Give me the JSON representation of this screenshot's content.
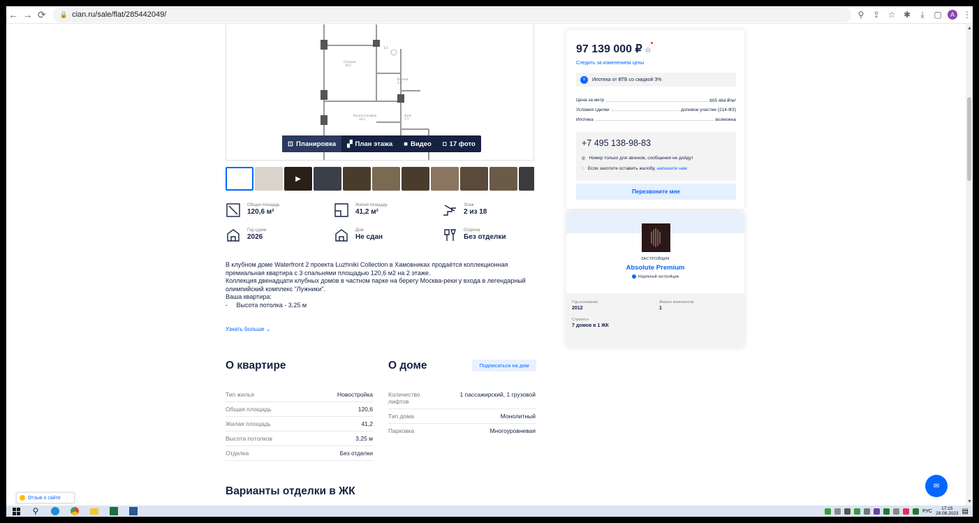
{
  "browser": {
    "url_host": "cian.ru",
    "url_path": "/sale/flat/285442049/"
  },
  "media": {
    "tabs": [
      {
        "label": "Планировка",
        "icon": "floorplan-icon"
      },
      {
        "label": "План этажа",
        "icon": "floor-plan-icon"
      },
      {
        "label": "Видео",
        "icon": "video-icon"
      },
      {
        "label": "17 фото",
        "icon": "camera-icon"
      }
    ],
    "thumb_colors": [
      "#ffffff",
      "#d8d4cc",
      "#2a1f17",
      "#3a3f49",
      "#4a3c2c",
      "#7a6a52",
      "#4b3b2c",
      "#8a7560",
      "#5a4a3a",
      "#6b5a48",
      "#3b3a3c",
      "#5a6070"
    ]
  },
  "facts": [
    {
      "label": "Общая площадь",
      "value": "120,6 м²",
      "icon": "area-icon"
    },
    {
      "label": "Жилая площадь",
      "value": "41,2 м²",
      "icon": "living-area-icon"
    },
    {
      "label": "Этаж",
      "value": "2 из 18",
      "icon": "stairs-icon"
    },
    {
      "label": "Год сдачи",
      "value": "2026",
      "icon": "building-year-icon"
    },
    {
      "label": "Дом",
      "value": "Не сдан",
      "icon": "building-icon"
    },
    {
      "label": "Отделка",
      "value": "Без отделки",
      "icon": "finishing-icon"
    }
  ],
  "description": {
    "lines": [
      "В клубном доме Waterfront 2 проекта Luzhniki Collection в Хамовниках продаётся коллекционная",
      "премиальная квартира с 3 спальнями площадью 120,6 м2 на 2 этаже.",
      "Коллекция двенадцати клубных домов в частном парке на берегу Москва-реки у входа в легендарный",
      "олимпийский комплекс \"Лужники\".",
      "Ваша квартира:",
      "-     Высота потолка - 3,25 м"
    ],
    "more": "Узнать больше"
  },
  "apartment": {
    "title": "О квартире",
    "rows": [
      {
        "k": "Тип жилья",
        "v": "Новостройка"
      },
      {
        "k": "Общая площадь",
        "v": "120,6"
      },
      {
        "k": "Жилая площадь",
        "v": "41,2"
      },
      {
        "k": "Высота потолков",
        "v": "3,25 м"
      },
      {
        "k": "Отделка",
        "v": "Без отделки"
      }
    ]
  },
  "house": {
    "title": "О доме",
    "subscribe": "Подписаться на дом",
    "rows": [
      {
        "k": "Количество лифтов",
        "v": "1 пассажирский, 1 грузовой"
      },
      {
        "k": "Тип дома",
        "v": "Монолитный"
      },
      {
        "k": "Парковка",
        "v": "Многоуровневая"
      }
    ]
  },
  "finishes_title": "Варианты отделки в ЖК",
  "price": {
    "value": "97 139 000 ₽",
    "follow": "Следить за изменением цены",
    "mortgage_promo": "Ипотека от ВТБ со скидкой 3%",
    "details": [
      {
        "k": "Цена за метр",
        "v": "805 464 ₽/м²"
      },
      {
        "k": "Условия сделки",
        "v": "долевое участие (214-ФЗ)"
      },
      {
        "k": "Ипотека",
        "v": "возможна"
      }
    ],
    "phone": "+7 495 138-98-83",
    "note_calls": "Номер только для звонков, сообщения не дойдут",
    "note_complaint": "Если захотите оставить жалобу,",
    "note_complaint_link": "напишите нам",
    "callback": "Перезвоните мне"
  },
  "developer": {
    "role": "ЗАСТРОЙЩИК",
    "name": "Absolute Premium",
    "reliable": "Надежный застройщик",
    "stats": [
      {
        "label": "Год основания",
        "value": "2012"
      },
      {
        "label": "Жилых комплексов",
        "value": "1"
      },
      {
        "label": "Строится",
        "value": "7 домов в 1 ЖК"
      }
    ]
  },
  "feedback": "Отзыв о сайте",
  "taskbar": {
    "lang": "РУС",
    "time": "17:15",
    "date": "28.08.2023"
  },
  "colors": {
    "accent": "#0468ff",
    "text": "#152242"
  }
}
